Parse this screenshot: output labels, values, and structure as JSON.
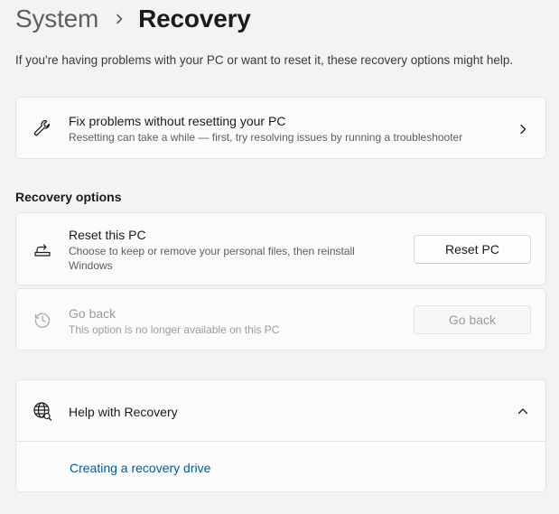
{
  "breadcrumb": {
    "parent": "System",
    "current": "Recovery"
  },
  "intro_text": "If you're having problems with your PC or want to reset it, these recovery options might help.",
  "fix_card": {
    "title": "Fix problems without resetting your PC",
    "subtitle": "Resetting can take a while — first, try resolving issues by running a troubleshooter",
    "icon": "wrench-icon"
  },
  "recovery_options": {
    "label": "Recovery options",
    "reset": {
      "title": "Reset this PC",
      "subtitle_line1": "Choose to keep or remove your personal files, then reinstall",
      "subtitle_line2": "Windows",
      "button": "Reset PC",
      "icon": "reset-pc-icon"
    },
    "go_back": {
      "title": "Go back",
      "subtitle": "This option is no longer available on this PC",
      "button": "Go back",
      "icon": "history-icon",
      "enabled": false
    }
  },
  "help": {
    "title": "Help with Recovery",
    "icon": "globe-icon",
    "expanded": true,
    "link": "Creating a recovery drive"
  },
  "colors": {
    "background": "#f3f3f3",
    "card": "#fbfbfb",
    "link": "#005a9e",
    "disabled": "#9b9b9b"
  }
}
